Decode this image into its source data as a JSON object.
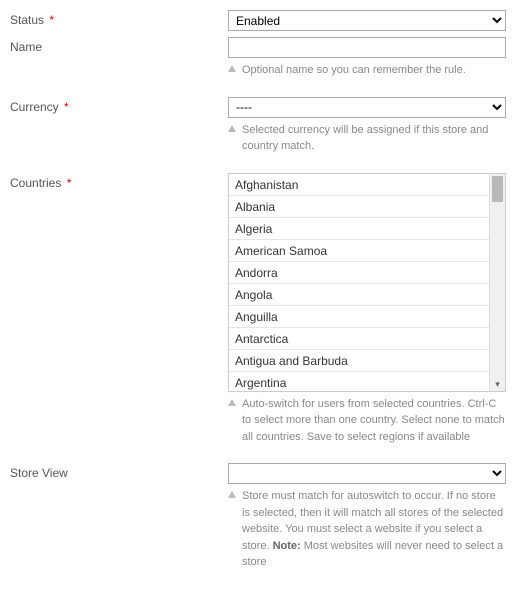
{
  "fields": {
    "status": {
      "label": "Status",
      "required": "*",
      "value": "Enabled"
    },
    "name": {
      "label": "Name",
      "required": "",
      "value": "",
      "hint": "Optional name so you can remember the rule."
    },
    "currency": {
      "label": "Currency",
      "required": "*",
      "value": "----",
      "hint": "Selected currency will be assigned if this store and country match."
    },
    "countries": {
      "label": "Countries",
      "required": "*",
      "options": [
        "Afghanistan",
        "Albania",
        "Algeria",
        "American Samoa",
        "Andorra",
        "Angola",
        "Anguilla",
        "Antarctica",
        "Antigua and Barbuda",
        "Argentina"
      ],
      "hint": "Auto-switch for users from selected countries. Ctrl-C to select more than one country. Select none to match all countries. Save to select regions if available"
    },
    "storeview": {
      "label": "Store View",
      "required": "",
      "value": "",
      "hint_pre": "Store must match for autoswitch to occur. If no store is selected, then it will match all stores of the selected website. You must select a website if you select a store. ",
      "hint_bold": "Note:",
      "hint_post": " Most websites will never need to select a store"
    }
  }
}
